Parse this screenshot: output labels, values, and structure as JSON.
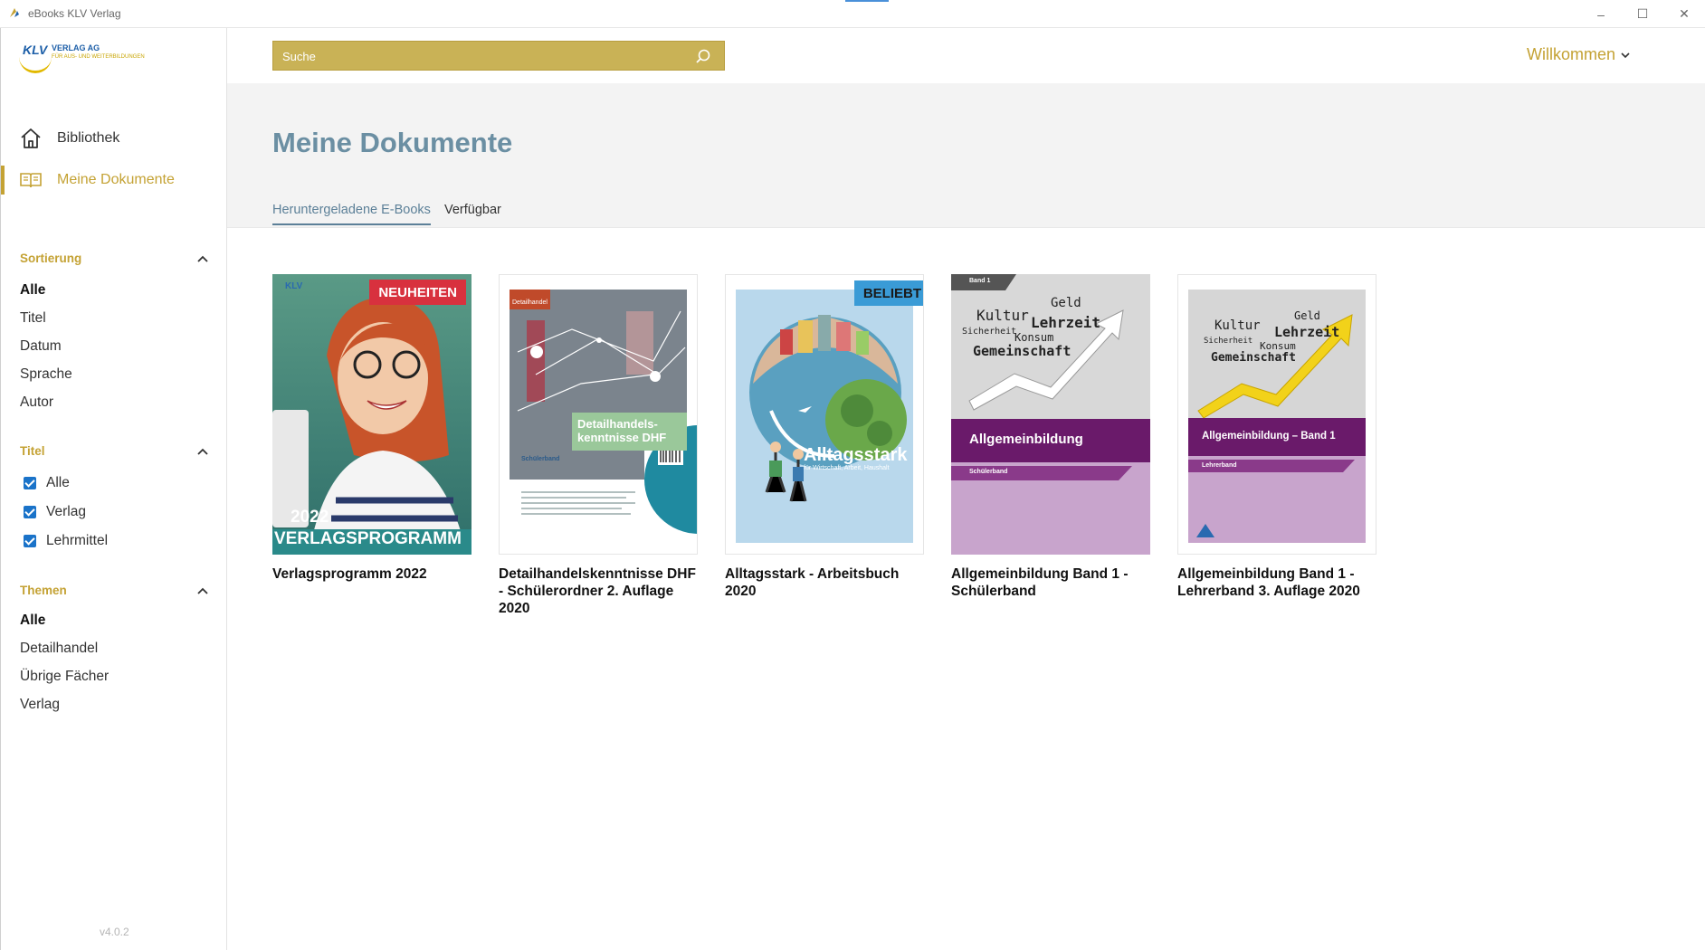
{
  "window": {
    "title": "eBooks KLV Verlag",
    "minimize": "–",
    "maximize": "☐",
    "close": "✕"
  },
  "logo": {
    "brand": "KLV",
    "name": "VERLAG AG",
    "tagline": "FÜR AUS- UND WEITERBILDUNGEN"
  },
  "nav": [
    {
      "label": "Bibliothek",
      "icon": "home-icon",
      "active": false
    },
    {
      "label": "Meine Dokumente",
      "icon": "open-book-icon",
      "active": true
    }
  ],
  "sorting": {
    "title": "Sortierung",
    "options": [
      "Alle",
      "Titel",
      "Datum",
      "Sprache",
      "Autor"
    ],
    "selected": "Alle"
  },
  "title_filter": {
    "title": "Titel",
    "options": [
      {
        "label": "Alle",
        "checked": true
      },
      {
        "label": "Verlag",
        "checked": true
      },
      {
        "label": "Lehrmittel",
        "checked": true
      }
    ]
  },
  "themes": {
    "title": "Themen",
    "options": [
      "Alle",
      "Detailhandel",
      "Übrige Fächer",
      "Verlag"
    ],
    "selected": "Alle"
  },
  "version": "v4.0.2",
  "search": {
    "placeholder": "Suche"
  },
  "user": {
    "welcome": "Willkommen"
  },
  "page": {
    "title": "Meine Dokumente"
  },
  "tabs": [
    {
      "label": "Heruntergeladene E-Books",
      "active": true
    },
    {
      "label": "Verfügbar",
      "active": false
    }
  ],
  "colors": {
    "accent": "#c4a234",
    "title_blue": "#6b8fa3",
    "checkbox": "#1a73c9",
    "badge_new": "#d8313e",
    "badge_popular": "#3a9bd6"
  },
  "books": [
    {
      "title": "Verlagsprogramm 2022",
      "badge": "NEUHEITEN",
      "cover_text": {
        "year": "2022",
        "banner": "VERLAGSPROGRAMM",
        "logo": "KLV"
      }
    },
    {
      "title": "Detailhandelskenntnisse DHF - Schülerordner 2. Auflage 2020",
      "badge": "",
      "cover_text": {
        "tag": "Detailhandel",
        "heading": "Detailhandels-\nkenntnisse DHF",
        "sub": "Schülerband"
      }
    },
    {
      "title": "Alltagsstark - Arbeitsbuch 2020",
      "badge": "BELIEBT",
      "cover_text": {
        "heading": "Alltagsstark",
        "sub": "für Wirtschaft, Arbeit, Haushalt"
      }
    },
    {
      "title": "Allgemeinbildung Band 1 - Schülerband",
      "badge": "",
      "cover_text": {
        "band": "Band 1",
        "words": [
          "Kultur",
          "Geld",
          "Lehrzeit",
          "Sicherheit",
          "Konsum",
          "Gemeinschaft"
        ],
        "heading": "Allgemeinbildung",
        "sub": "Schülerband"
      }
    },
    {
      "title": "Allgemeinbildung Band 1 - Lehrerband 3. Auflage 2020",
      "badge": "",
      "cover_text": {
        "words": [
          "Kultur",
          "Geld",
          "Lehrzeit",
          "Sicherheit",
          "Konsum",
          "Gemeinschaft"
        ],
        "heading": "Allgemeinbildung – Band 1",
        "sub": "Lehrerband"
      }
    }
  ]
}
